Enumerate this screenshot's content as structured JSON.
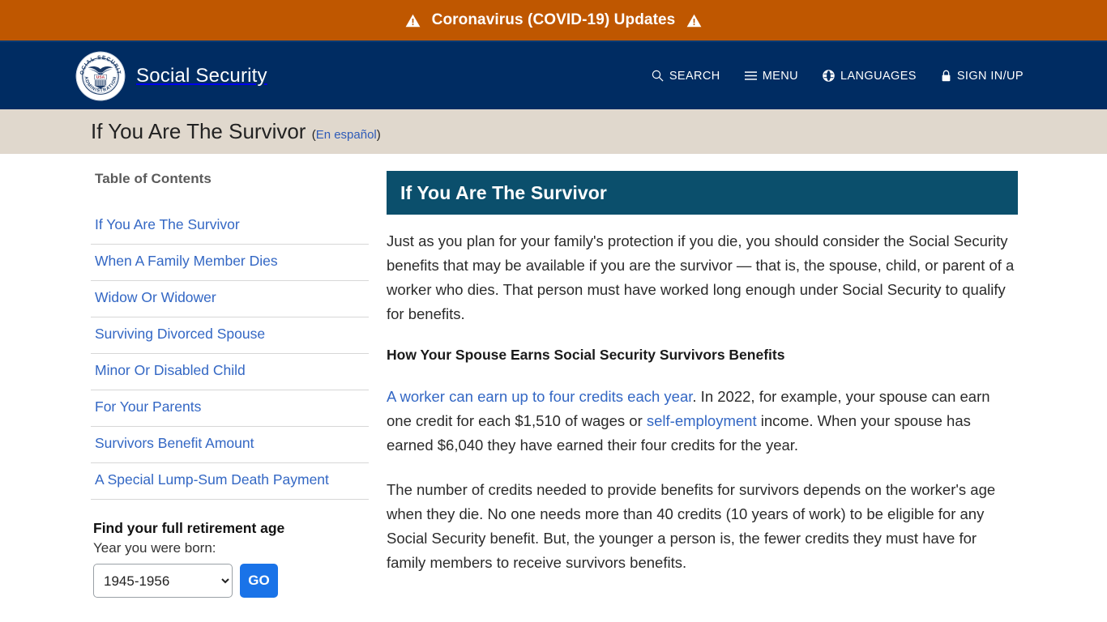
{
  "alert": {
    "text": "Coronavirus (COVID-19) Updates",
    "icon_left": "warning-triangle-icon",
    "icon_right": "warning-triangle-icon",
    "background": "#bf5700"
  },
  "header": {
    "background": "#002c62",
    "brand_title": "Social Security",
    "seal": {
      "top_arc_text": "SOCIAL SECURITY",
      "bottom_arc_text": "ADMINISTRATION",
      "banner_text": "USA"
    },
    "nav": [
      {
        "label": "SEARCH",
        "icon": "search-icon"
      },
      {
        "label": "MENU",
        "icon": "hamburger-menu-icon"
      },
      {
        "label": "LANGUAGES",
        "icon": "globe-icon"
      },
      {
        "label": "SIGN IN/UP",
        "icon": "lock-icon"
      }
    ]
  },
  "page_title": {
    "text": "If You Are The Survivor",
    "spanish_link": "En español",
    "background": "#e0d8cd"
  },
  "sidebar": {
    "toc_heading": "Table of Contents",
    "toc_items": [
      {
        "label": "If You Are The Survivor"
      },
      {
        "label": "When A Family Member Dies"
      },
      {
        "label": "Widow Or Widower"
      },
      {
        "label": "Surviving Divorced Spouse"
      },
      {
        "label": "Minor Or Disabled Child"
      },
      {
        "label": "For Your Parents"
      },
      {
        "label": "Survivors Benefit Amount"
      },
      {
        "label": "A Special Lump-Sum Death Payment"
      }
    ],
    "retirement_tool": {
      "heading": "Find your full retirement age",
      "label": "Year you were born:",
      "selected_value": "1945-1956",
      "options": [
        "1945-1956"
      ],
      "go_label": "GO",
      "go_color": "#1a73e8"
    }
  },
  "main": {
    "banner_title": "If You Are The Survivor",
    "banner_color": "#0b4f6c",
    "paragraph_1": "Just as you plan for your family's protection if you die, you should consider the Social Security benefits that may be available if you are the survivor — that is, the spouse, child, or parent of a worker who dies. That person must have worked long enough under Social Security to qualify for benefits.",
    "section_heading": "How Your Spouse Earns Social Security Survivors Benefits",
    "paragraph_2": {
      "link_1": "A worker can earn up to four credits each year",
      "text_1": ". In 2022, for example, your spouse can earn one credit for each $1,510 of wages or ",
      "link_2": "self-employment",
      "text_2": " income. When your spouse has earned $6,040 they have earned their four credits for the year."
    },
    "paragraph_3": "The number of credits needed to provide benefits for survivors depends on the worker's age when they die. No one needs more than 40 credits (10 years of work) to be eligible for any Social Security benefit. But, the younger a person is, the fewer credits they must have for family members to receive survivors benefits."
  }
}
